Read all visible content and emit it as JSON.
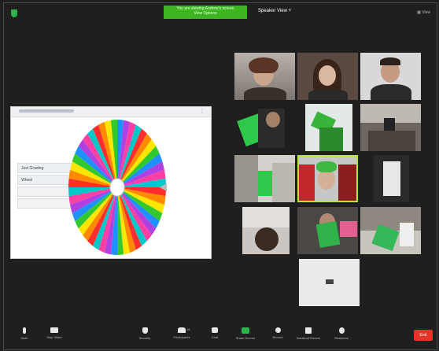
{
  "top": {
    "banner_line1": "You are viewing Andrew's screen",
    "banner_line2": "View Options",
    "speaker_view": "Speaker View",
    "view_label": "View"
  },
  "share": {
    "list_items": [
      "Just Grading",
      "Wheel"
    ]
  },
  "controls": {
    "mute": "Mute",
    "stop_video": "Stop Video",
    "security": "Security",
    "participants": "Participants",
    "participants_count": "18",
    "chat": "Chat",
    "share_screen": "Share Screen",
    "record": "Record",
    "breakout": "Breakout Rooms",
    "reactions": "Reactions",
    "end": "End"
  },
  "colors": {
    "share_green": "#2eb34a",
    "end_red": "#e5332a",
    "wheel": [
      "#ff2d2d",
      "#ff8a00",
      "#ffe600",
      "#31c830",
      "#1e90ff",
      "#b040e0",
      "#ff3fa3",
      "#00c8c8"
    ]
  }
}
